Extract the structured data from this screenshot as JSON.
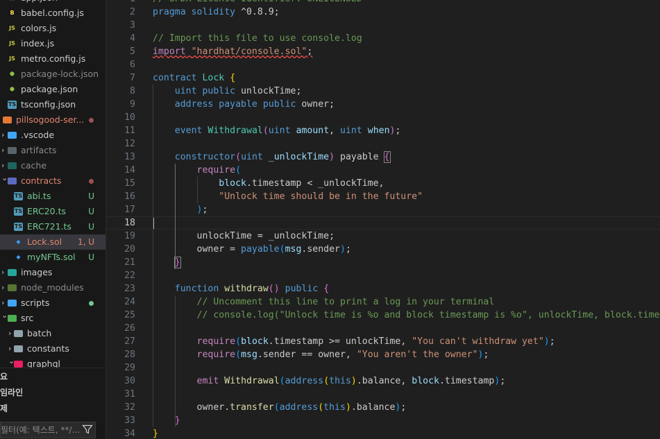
{
  "explorer": {
    "items": [
      {
        "label": "app.json",
        "indent": 1,
        "icon": "json",
        "color": "#cbcb41"
      },
      {
        "label": "babel.config.js",
        "indent": 1,
        "icon": "babel",
        "color": "#f5da55"
      },
      {
        "label": "colors.js",
        "indent": 1,
        "icon": "js",
        "color": "#cbcb41"
      },
      {
        "label": "index.js",
        "indent": 1,
        "icon": "js",
        "color": "#cbcb41"
      },
      {
        "label": "metro.config.js",
        "indent": 1,
        "icon": "js",
        "color": "#cbcb41"
      },
      {
        "label": "package-lock.json",
        "indent": 1,
        "icon": "npm",
        "color": "#8bc34a",
        "dim": true
      },
      {
        "label": "package.json",
        "indent": 1,
        "icon": "npm",
        "color": "#8bc34a"
      },
      {
        "label": "tsconfig.json",
        "indent": 1,
        "icon": "ts",
        "color": "#519aba"
      },
      {
        "label": "pillsogood-ser...",
        "indent": 0,
        "icon": "folder-open",
        "color": "#e37933",
        "textColor": "#e2856e",
        "dot": "#9b5151"
      },
      {
        "label": ".vscode",
        "indent": 1,
        "icon": "folder-vscode",
        "color": "#42a5f5",
        "chev": ">"
      },
      {
        "label": "artifacts",
        "indent": 1,
        "icon": "folder",
        "color": "#90a4ae",
        "chev": ">",
        "dim": true
      },
      {
        "label": "cache",
        "indent": 1,
        "icon": "folder-cache",
        "color": "#26a69a",
        "chev": ">",
        "dim": true
      },
      {
        "label": "contracts",
        "indent": 1,
        "icon": "folder-open",
        "color": "#5c6bc0",
        "chev": "v",
        "textColor": "#e2856e",
        "dot": "#9b5151"
      },
      {
        "label": "abi.ts",
        "indent": 2,
        "icon": "ts",
        "color": "#519aba",
        "badge": "U",
        "badgeColor": "#73c991",
        "textColor": "#73c991"
      },
      {
        "label": "ERC20.ts",
        "indent": 2,
        "icon": "ts",
        "color": "#519aba",
        "badge": "U",
        "badgeColor": "#73c991",
        "textColor": "#73c991"
      },
      {
        "label": "ERC721.ts",
        "indent": 2,
        "icon": "ts",
        "color": "#519aba",
        "badge": "U",
        "badgeColor": "#73c991",
        "textColor": "#73c991"
      },
      {
        "label": "Lock.sol",
        "indent": 2,
        "icon": "sol",
        "color": "#3c9ef0",
        "badge": "1, U",
        "badgeColor": "#e2856e",
        "textColor": "#e2856e",
        "selected": true
      },
      {
        "label": "myNFTs.sol",
        "indent": 2,
        "icon": "sol",
        "color": "#3c9ef0",
        "badge": "U",
        "badgeColor": "#73c991",
        "textColor": "#73c991"
      },
      {
        "label": "images",
        "indent": 1,
        "icon": "folder-images",
        "color": "#26a69a",
        "chev": ">"
      },
      {
        "label": "node_modules",
        "indent": 1,
        "icon": "folder-node",
        "color": "#8bc34a",
        "chev": ">",
        "dim": true
      },
      {
        "label": "scripts",
        "indent": 1,
        "icon": "folder-scripts",
        "color": "#42a5f5",
        "chev": ">",
        "dot": "#73c991"
      },
      {
        "label": "src",
        "indent": 1,
        "icon": "folder-src",
        "color": "#4caf50",
        "chev": "v"
      },
      {
        "label": "batch",
        "indent": 2,
        "icon": "folder",
        "color": "#90a4ae",
        "chev": ">"
      },
      {
        "label": "constants",
        "indent": 2,
        "icon": "folder",
        "color": "#90a4ae",
        "chev": ">"
      },
      {
        "label": "graphql",
        "indent": 2,
        "icon": "folder",
        "color": "#e91e63",
        "chev": "v"
      }
    ],
    "sections": [
      "요",
      "임라인",
      "제"
    ],
    "filter_placeholder": "필터(예: 텍스트, **/..."
  },
  "editor": {
    "current_line": 18,
    "lines": [
      {
        "n": 1,
        "html": "<span class='c'>// SPDX-License-Identifier: UNLICENSED</span>"
      },
      {
        "n": 2,
        "html": "<span class='k'>pragma</span> <span class='k'>solidity</span> ^0.8.9;"
      },
      {
        "n": 3,
        "html": ""
      },
      {
        "n": 4,
        "html": "<span class='c'>// Import this file to use console.log</span>"
      },
      {
        "n": 5,
        "html": "<span class='squig'><span class='kc'>import</span> <span class='s'>\"hardhat/console.sol\"</span>;</span>"
      },
      {
        "n": 6,
        "html": ""
      },
      {
        "n": 7,
        "html": "<span class='k'>contract</span> <span class='t'>Lock</span> <span class='y'>{</span>"
      },
      {
        "n": 8,
        "html": "    <span class='k'>uint</span> <span class='k'>public</span> unlockTime;"
      },
      {
        "n": 9,
        "html": "    <span class='k'>address</span> <span class='k'>payable</span> <span class='k'>public</span> owner;"
      },
      {
        "n": 10,
        "html": ""
      },
      {
        "n": 11,
        "html": "    <span class='k'>event</span> <span class='t'>Withdrawal</span><span class='pb'>(</span><span class='k'>uint</span> <span class='v'>amount</span>, <span class='k'>uint</span> <span class='v'>when</span><span class='pb'>)</span>;"
      },
      {
        "n": 12,
        "html": ""
      },
      {
        "n": 13,
        "html": "    <span class='k'>constructor</span><span class='pb'>(</span><span class='k'>uint</span> <span class='v'>_unlockTime</span><span class='pb'>)</span> payable <span class='pb bm'>{</span>"
      },
      {
        "n": 14,
        "html": "        <span class='kc'>require</span><span class='bl'>(</span>"
      },
      {
        "n": 15,
        "html": "            <span class='v'>block</span>.timestamp &lt; _unlockTime,"
      },
      {
        "n": 16,
        "html": "            <span class='s'>\"Unlock time should be in the future\"</span>"
      },
      {
        "n": 17,
        "html": "        <span class='bl'>)</span>;"
      },
      {
        "n": 18,
        "html": ""
      },
      {
        "n": 19,
        "html": "        unlockTime = _unlockTime;"
      },
      {
        "n": 20,
        "html": "        owner = <span class='k'>payable</span><span class='bl'>(</span><span class='v'>msg</span>.sender<span class='bl'>)</span>;"
      },
      {
        "n": 21,
        "html": "    <span class='pb bm'>}</span>"
      },
      {
        "n": 22,
        "html": ""
      },
      {
        "n": 23,
        "html": "    <span class='k'>function</span> <span class='f'>withdraw</span><span class='pb'>()</span> <span class='k'>public</span> <span class='pb'>{</span>"
      },
      {
        "n": 24,
        "html": "        <span class='c'>// Uncomment this line to print a log in your terminal</span>"
      },
      {
        "n": 25,
        "html": "        <span class='c'>// console.log(\"Unlock time is %o and block timestamp is %o\", unlockTime, block.timestamp);</span>"
      },
      {
        "n": 26,
        "html": ""
      },
      {
        "n": 27,
        "html": "        <span class='kc'>require</span><span class='bl'>(</span><span class='v'>block</span>.timestamp &gt;= unlockTime, <span class='s'>\"You can't withdraw yet\"</span><span class='bl'>)</span>;"
      },
      {
        "n": 28,
        "html": "        <span class='kc'>require</span><span class='bl'>(</span><span class='v'>msg</span>.sender == owner, <span class='s'>\"You aren't the owner\"</span><span class='bl'>)</span>;"
      },
      {
        "n": 29,
        "html": ""
      },
      {
        "n": 30,
        "html": "        <span class='kc'>emit</span> <span class='f'>Withdrawal</span><span class='bl'>(</span><span class='k'>address</span><span class='y'>(</span><span class='k'>this</span><span class='y'>)</span>.balance, <span class='v'>block</span>.timestamp<span class='bl'>)</span>;"
      },
      {
        "n": 31,
        "html": ""
      },
      {
        "n": 32,
        "html": "        owner.<span class='f'>transfer</span><span class='bl'>(</span><span class='k'>address</span><span class='y'>(</span><span class='k'>this</span><span class='y'>)</span>.balance<span class='bl'>)</span>;"
      },
      {
        "n": 33,
        "html": "    <span class='pb'>}</span>"
      },
      {
        "n": 34,
        "html": "<span class='y'>}</span>"
      }
    ]
  }
}
